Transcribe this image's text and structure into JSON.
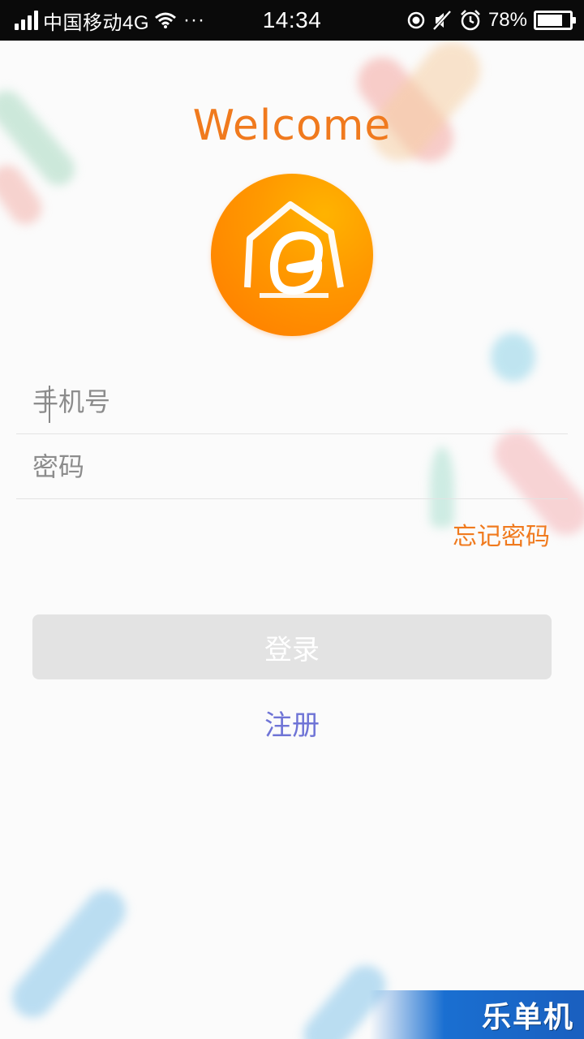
{
  "status_bar": {
    "carrier": "中国移动4G",
    "more": "···",
    "time": "14:34",
    "battery_text": "78%",
    "battery_level": 0.78,
    "icons": [
      "signal-icon",
      "wifi-icon",
      "location-icon",
      "mute-icon",
      "alarm-icon",
      "battery-icon"
    ]
  },
  "header": {
    "welcome": "Welcome"
  },
  "logo": {
    "icon": "house-e-logo",
    "colors": {
      "start": "#ffb300",
      "end": "#ff7a00"
    }
  },
  "form": {
    "phone_placeholder": "手机号",
    "password_placeholder": "密码",
    "forgot_password": "忘记密码",
    "login_button": "登录",
    "register": "注册"
  },
  "watermark": {
    "text": "乐单机"
  },
  "colors": {
    "accent_orange": "#f07a1e",
    "register_link": "#6f74d6",
    "button_disabled": "#e3e3e3"
  }
}
